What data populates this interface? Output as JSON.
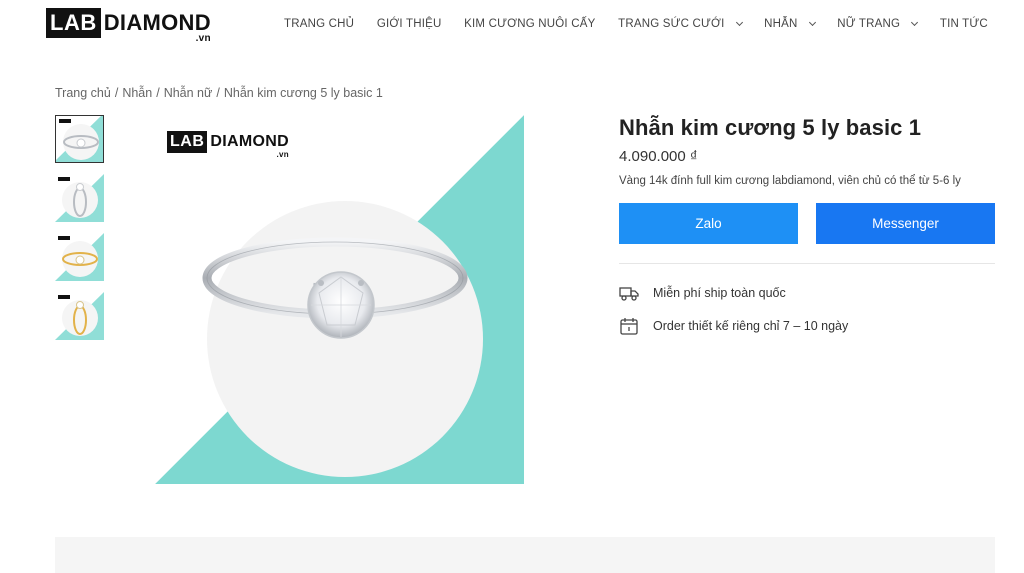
{
  "header": {
    "logo": {
      "box": "LAB",
      "word": "DIAMOND",
      "sub": ".vn"
    },
    "nav": [
      {
        "label": "TRANG CHỦ",
        "dropdown": false
      },
      {
        "label": "GIỚI THIỆU",
        "dropdown": false
      },
      {
        "label": "KIM CƯƠNG NUÔI CẤY",
        "dropdown": false
      },
      {
        "label": "TRANG SỨC CƯỚI",
        "dropdown": true
      },
      {
        "label": "NHẪN",
        "dropdown": true
      },
      {
        "label": "NỮ TRANG",
        "dropdown": true
      },
      {
        "label": "TIN TỨC",
        "dropdown": false
      }
    ]
  },
  "breadcrumb": [
    "Trang chủ",
    "Nhẫn",
    "Nhẫn nữ",
    "Nhẫn kim cương 5 ly basic 1"
  ],
  "gallery": {
    "thumbnails": [
      {
        "metal": "white",
        "view": "angled"
      },
      {
        "metal": "white",
        "view": "side"
      },
      {
        "metal": "gold",
        "view": "angled"
      },
      {
        "metal": "gold",
        "view": "side"
      }
    ],
    "main_logo": {
      "box": "LAB",
      "word": "DIAMOND",
      "sub": ".vn"
    }
  },
  "product": {
    "title": "Nhẫn kim cương 5 ly basic 1",
    "price": "4.090.000 ₫",
    "description": "Vàng 14k đính full kim cương labdiamond, viên chủ có thể từ 5-6 ly",
    "buttons": {
      "zalo": "Zalo",
      "messenger": "Messenger"
    },
    "features": [
      {
        "icon": "truck-icon",
        "text": "Miễn phí ship toàn quốc"
      },
      {
        "icon": "calendar-icon",
        "text": "Order thiết kế riêng chỉ 7 – 10 ngày"
      }
    ]
  },
  "colors": {
    "accent_teal": "#7dd8d0",
    "zalo_blue": "#1e90f5",
    "messenger_blue": "#1877f2"
  }
}
